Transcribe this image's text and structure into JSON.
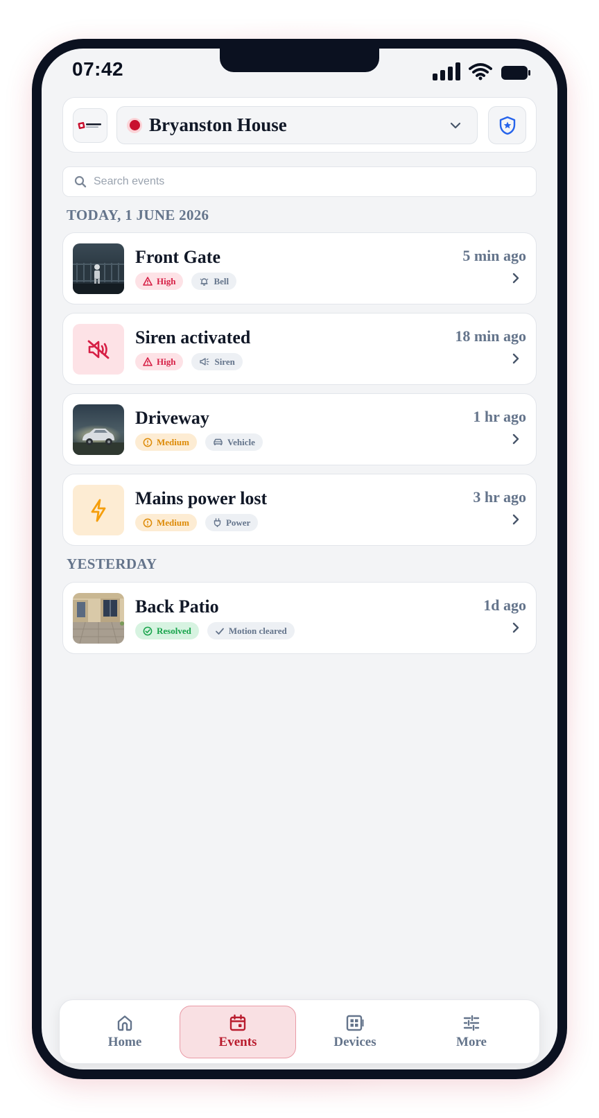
{
  "status_bar": {
    "time": "07:42"
  },
  "header": {
    "site_name": "Bryanston House",
    "logo_text": "ClearCam"
  },
  "search": {
    "placeholder": "Search events",
    "value": ""
  },
  "sections": [
    {
      "label": "TODAY, 1 JUNE 2026",
      "events": [
        {
          "title": "Front Gate",
          "time": "5 min ago",
          "severity": "High",
          "tag": "Bell",
          "thumb": "camera-front-gate"
        },
        {
          "title": "Siren activated",
          "time": "18 min ago",
          "severity": "High",
          "tag": "Siren",
          "thumb": "siren-muted-icon"
        },
        {
          "title": "Driveway",
          "time": "1 hr ago",
          "severity": "Medium",
          "tag": "Vehicle",
          "thumb": "camera-driveway"
        },
        {
          "title": "Mains power lost",
          "time": "3 hr ago",
          "severity": "Medium",
          "tag": "Power",
          "thumb": "lightning-icon"
        }
      ]
    },
    {
      "label": "YESTERDAY",
      "events": [
        {
          "title": "Back Patio",
          "time": "1d ago",
          "severity": "Resolved",
          "tag": "Motion cleared",
          "thumb": "camera-back-patio"
        }
      ]
    }
  ],
  "nav": {
    "items": [
      {
        "label": "Home",
        "icon": "home-icon",
        "active": false
      },
      {
        "label": "Events",
        "icon": "calendar-icon",
        "active": true
      },
      {
        "label": "Devices",
        "icon": "devices-icon",
        "active": false
      },
      {
        "label": "More",
        "icon": "sliders-icon",
        "active": false
      }
    ]
  },
  "colors": {
    "brand_red": "#c8102e",
    "high": "#d61f45",
    "medium": "#dd8a06",
    "resolved": "#16a34a",
    "muted": "#64748b",
    "shield_blue": "#2563eb"
  }
}
